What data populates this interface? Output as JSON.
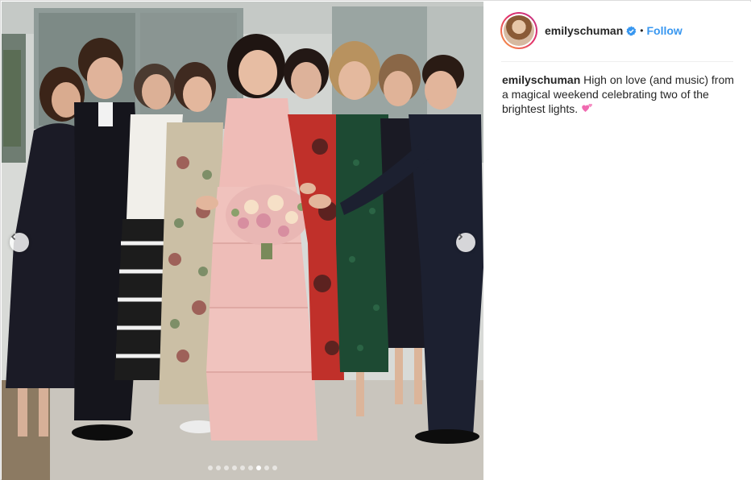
{
  "post": {
    "username": "emilyschuman",
    "follow_label": "Follow",
    "bullet": "•",
    "caption": "High on love (and music) from a magical weekend celebrating two of the brightest lights.",
    "caption_emoji": "two-hearts-icon"
  },
  "carousel": {
    "slide_count": 9,
    "active_slide": 7
  },
  "colors": {
    "follow": "#3897f0",
    "verified": "#3897f0",
    "border": "#dbdbdb"
  }
}
